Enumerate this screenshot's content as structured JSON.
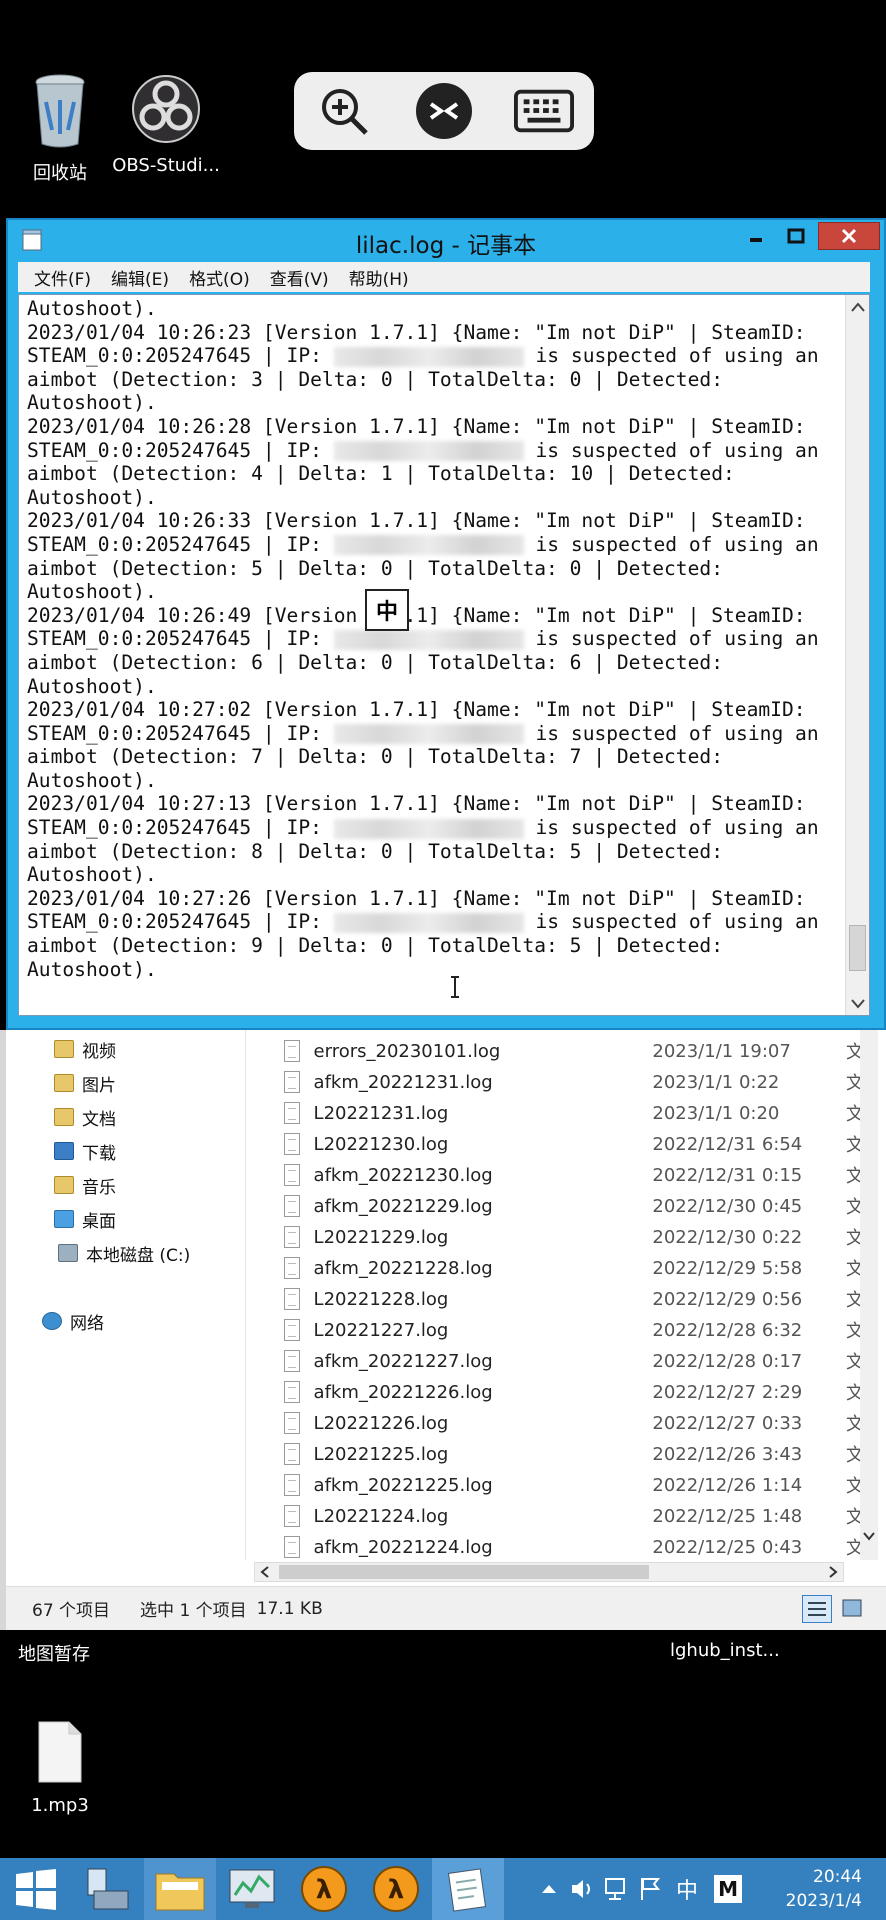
{
  "desktop": {
    "icons": [
      {
        "label": "回收站",
        "icon": "recycle-bin-icon"
      },
      {
        "label": "OBS-Studi...",
        "icon": "obs-icon"
      },
      {
        "label": "地图暂存",
        "icon": "folder-icon"
      },
      {
        "label": "lghub_inst...",
        "icon": "installer-icon"
      },
      {
        "label": "1.mp3",
        "icon": "file-icon"
      }
    ]
  },
  "remote_toolbar": {
    "buttons": [
      "zoom-in-icon",
      "remote-desktop-icon",
      "keyboard-icon"
    ]
  },
  "notepad": {
    "title": "lilac.log - 记事本",
    "menu": [
      "文件(F)",
      "编辑(E)",
      "格式(O)",
      "查看(V)",
      "帮助(H)"
    ],
    "lines": [
      "Autoshoot).",
      "2023/01/04 10:26:23 [Version 1.7.1] {Name: \"Im not DiP\" | SteamID:",
      "STEAM_0:0:205247645 | IP: ",
      "aimbot (Detection: 3 | Delta: 0 | TotalDelta: 0 | Detected:",
      "Autoshoot).",
      "2023/01/04 10:26:28 [Version 1.7.1] {Name: \"Im not DiP\" | SteamID:",
      "STEAM_0:0:205247645 | IP: ",
      "aimbot (Detection: 4 | Delta: 1 | TotalDelta: 10 | Detected:",
      "Autoshoot).",
      "2023/01/04 10:26:33 [Version 1.7.1] {Name: \"Im not DiP\" | SteamID:",
      "STEAM_0:0:205247645 | IP: ",
      "aimbot (Detection: 5 | Delta: 0 | TotalDelta: 0 | Detected:",
      "Autoshoot).",
      "2023/01/04 10:26:49 [Version 1.7.1] {Name: \"Im not DiP\" | SteamID:",
      "STEAM_0:0:205247645 | IP: ",
      "aimbot (Detection: 6 | Delta: 0 | TotalDelta: 6 | Detected:",
      "Autoshoot).",
      "2023/01/04 10:27:02 [Version 1.7.1] {Name: \"Im not DiP\" | SteamID:",
      "STEAM_0:0:205247645 | IP: ",
      "aimbot (Detection: 7 | Delta: 0 | TotalDelta: 7 | Detected:",
      "Autoshoot).",
      "2023/01/04 10:27:13 [Version 1.7.1] {Name: \"Im not DiP\" | SteamID:",
      "STEAM_0:0:205247645 | IP: ",
      "aimbot (Detection: 8 | Delta: 0 | TotalDelta: 5 | Detected:",
      "Autoshoot).",
      "2023/01/04 10:27:26 [Version 1.7.1] {Name: \"Im not DiP\" | SteamID:",
      "STEAM_0:0:205247645 | IP: ",
      "aimbot (Detection: 9 | Delta: 0 | TotalDelta: 5 | Detected:",
      "Autoshoot)."
    ],
    "ip_suffix": "is suspected of using an",
    "ime_indicator": "中"
  },
  "explorer": {
    "nav": [
      {
        "label": "视频",
        "icon": "videos-folder-icon"
      },
      {
        "label": "图片",
        "icon": "pictures-folder-icon"
      },
      {
        "label": "文档",
        "icon": "documents-folder-icon"
      },
      {
        "label": "下载",
        "icon": "downloads-folder-icon"
      },
      {
        "label": "音乐",
        "icon": "music-folder-icon"
      },
      {
        "label": "桌面",
        "icon": "desktop-folder-icon"
      },
      {
        "label": "本地磁盘 (C:)",
        "icon": "drive-icon"
      },
      {
        "label": "网络",
        "icon": "network-icon"
      }
    ],
    "files": [
      {
        "name": "errors_20230101.log",
        "date": "2023/1/1 19:07",
        "type": "文"
      },
      {
        "name": "afkm_20221231.log",
        "date": "2023/1/1 0:22",
        "type": "文"
      },
      {
        "name": "L20221231.log",
        "date": "2023/1/1 0:20",
        "type": "文"
      },
      {
        "name": "L20221230.log",
        "date": "2022/12/31 6:54",
        "type": "文"
      },
      {
        "name": "afkm_20221230.log",
        "date": "2022/12/31 0:15",
        "type": "文"
      },
      {
        "name": "afkm_20221229.log",
        "date": "2022/12/30 0:45",
        "type": "文"
      },
      {
        "name": "L20221229.log",
        "date": "2022/12/30 0:22",
        "type": "文"
      },
      {
        "name": "afkm_20221228.log",
        "date": "2022/12/29 5:58",
        "type": "文"
      },
      {
        "name": "L20221228.log",
        "date": "2022/12/29 0:56",
        "type": "文"
      },
      {
        "name": "L20221227.log",
        "date": "2022/12/28 6:32",
        "type": "文"
      },
      {
        "name": "afkm_20221227.log",
        "date": "2022/12/28 0:17",
        "type": "文"
      },
      {
        "name": "afkm_20221226.log",
        "date": "2022/12/27 2:29",
        "type": "文"
      },
      {
        "name": "L20221226.log",
        "date": "2022/12/27 0:33",
        "type": "文"
      },
      {
        "name": "L20221225.log",
        "date": "2022/12/26 3:43",
        "type": "文"
      },
      {
        "name": "afkm_20221225.log",
        "date": "2022/12/26 1:14",
        "type": "文"
      },
      {
        "name": "L20221224.log",
        "date": "2022/12/25 1:48",
        "type": "文"
      },
      {
        "name": "afkm_20221224.log",
        "date": "2022/12/25 0:43",
        "type": "文"
      }
    ],
    "status": {
      "count": "67 个项目",
      "selected": "选中 1 个项目",
      "size": "17.1 KB"
    }
  },
  "taskbar": {
    "clock_time": "20:44",
    "clock_date": "2023/1/4",
    "ime": "中",
    "ime_mode": "M"
  }
}
